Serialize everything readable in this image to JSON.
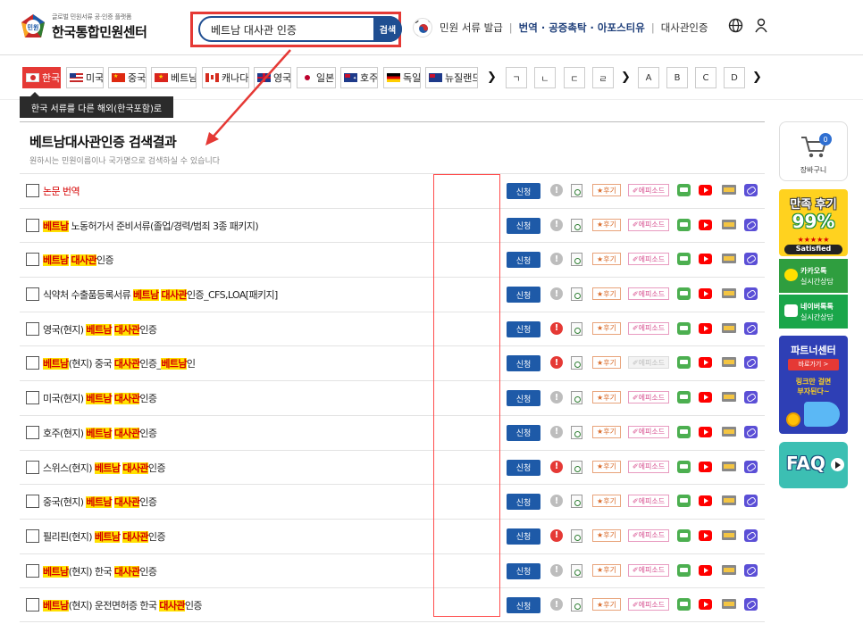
{
  "brand": {
    "subtitle": "글로벌 민원서류 공·인증 플랫폼",
    "title": "한국통합민원센터",
    "mark_text": "민원"
  },
  "search": {
    "value": "베트남 대사관 인증",
    "button": "검색"
  },
  "top_nav": {
    "item1": "민원 서류 발급",
    "item2": "번역 · 공증촉탁 · 아포스티유",
    "item3": "대사관인증"
  },
  "countries": [
    {
      "label": "한국",
      "flag": "kr",
      "active": true
    },
    {
      "label": "미국",
      "flag": "us"
    },
    {
      "label": "중국",
      "flag": "cn"
    },
    {
      "label": "베트남",
      "flag": "vn"
    },
    {
      "label": "캐나다",
      "flag": "ca"
    },
    {
      "label": "영국",
      "flag": "uk"
    },
    {
      "label": "일본",
      "flag": "jp"
    },
    {
      "label": "호주",
      "flag": "au"
    },
    {
      "label": "독일",
      "flag": "de"
    },
    {
      "label": "뉴질랜드",
      "flag": "nz"
    }
  ],
  "consonants": [
    "ㄱ",
    "ㄴ",
    "ㄷ",
    "ㄹ"
  ],
  "letters": [
    "A",
    "B",
    "C",
    "D"
  ],
  "tooltip": "한국 서류를 다른 해외(한국포함)로",
  "result": {
    "title": "베트남대사관인증 검색결과",
    "subtitle": "원하시는 민원이름이나 국가명으로 검색하실 수 있습니다"
  },
  "row_labels": {
    "apply": "신청",
    "review": "★후기",
    "episode": "✐에피소드",
    "info": "!"
  },
  "rows": [
    {
      "parts": [
        {
          "t": "논문 번역",
          "s": "red"
        }
      ],
      "excl": "gray",
      "doc_dim": true,
      "epi_dim": false
    },
    {
      "parts": [
        {
          "t": "베트남",
          "s": "hl"
        },
        {
          "t": " 노동허가서 준비서류(졸업/경력/범죄 3종 패키지)",
          "s": ""
        }
      ],
      "excl": "gray",
      "epi_dim": false
    },
    {
      "parts": [
        {
          "t": "베트남",
          "s": "hl"
        },
        {
          "t": " ",
          "s": ""
        },
        {
          "t": "대사관",
          "s": "hl"
        },
        {
          "t": "인증",
          "s": ""
        }
      ],
      "excl": "gray",
      "epi_dim": false
    },
    {
      "parts": [
        {
          "t": "식약처 수출품등록서류 ",
          "s": ""
        },
        {
          "t": "베트남",
          "s": "hl"
        },
        {
          "t": " ",
          "s": ""
        },
        {
          "t": "대사관",
          "s": "hl"
        },
        {
          "t": "인증_CFS,LOA[패키지]",
          "s": ""
        }
      ],
      "excl": "gray",
      "epi_dim": false
    },
    {
      "parts": [
        {
          "t": "영국(현지) ",
          "s": ""
        },
        {
          "t": "베트남",
          "s": "hl"
        },
        {
          "t": " ",
          "s": ""
        },
        {
          "t": "대사관",
          "s": "hl"
        },
        {
          "t": "인증",
          "s": ""
        }
      ],
      "excl": "red",
      "epi_dim": false
    },
    {
      "parts": [
        {
          "t": "베트남",
          "s": "hl"
        },
        {
          "t": "(현지) 중국 ",
          "s": ""
        },
        {
          "t": "대사관",
          "s": "hl"
        },
        {
          "t": "인증_",
          "s": ""
        },
        {
          "t": "베트남",
          "s": "hl"
        },
        {
          "t": "인",
          "s": ""
        }
      ],
      "excl": "red",
      "epi_dim": true
    },
    {
      "parts": [
        {
          "t": "미국(현지) ",
          "s": ""
        },
        {
          "t": "베트남",
          "s": "hl"
        },
        {
          "t": " ",
          "s": ""
        },
        {
          "t": "대사관",
          "s": "hl"
        },
        {
          "t": "인증",
          "s": ""
        }
      ],
      "excl": "gray",
      "epi_dim": false
    },
    {
      "parts": [
        {
          "t": "호주(현지) ",
          "s": ""
        },
        {
          "t": "베트남",
          "s": "hl"
        },
        {
          "t": " ",
          "s": ""
        },
        {
          "t": "대사관",
          "s": "hl"
        },
        {
          "t": "인증",
          "s": ""
        }
      ],
      "excl": "gray",
      "epi_dim": false
    },
    {
      "parts": [
        {
          "t": "스위스(현지) ",
          "s": ""
        },
        {
          "t": "베트남",
          "s": "hl"
        },
        {
          "t": " ",
          "s": ""
        },
        {
          "t": "대사관",
          "s": "hl"
        },
        {
          "t": "인증",
          "s": ""
        }
      ],
      "excl": "red",
      "epi_dim": false
    },
    {
      "parts": [
        {
          "t": "중국(현지) ",
          "s": ""
        },
        {
          "t": "베트남",
          "s": "hl"
        },
        {
          "t": " ",
          "s": ""
        },
        {
          "t": "대사관",
          "s": "hl"
        },
        {
          "t": "인증",
          "s": ""
        }
      ],
      "excl": "gray",
      "epi_dim": false
    },
    {
      "parts": [
        {
          "t": "필리핀(현지) ",
          "s": ""
        },
        {
          "t": "베트남",
          "s": "hl"
        },
        {
          "t": " ",
          "s": ""
        },
        {
          "t": "대사관",
          "s": "hl"
        },
        {
          "t": "인증",
          "s": ""
        }
      ],
      "excl": "red",
      "epi_dim": false
    },
    {
      "parts": [
        {
          "t": "베트남",
          "s": "hl"
        },
        {
          "t": "(현지) 한국 ",
          "s": ""
        },
        {
          "t": "대사관",
          "s": "hl"
        },
        {
          "t": "인증",
          "s": ""
        }
      ],
      "excl": "gray",
      "epi_dim": false
    },
    {
      "parts": [
        {
          "t": "베트남",
          "s": "hl"
        },
        {
          "t": "(현지) 운전면허증 한국 ",
          "s": ""
        },
        {
          "t": "대사관",
          "s": "hl"
        },
        {
          "t": "인증",
          "s": ""
        }
      ],
      "excl": "gray",
      "epi_dim": false
    }
  ],
  "sidebar": {
    "cart_label": "장바구니",
    "cart_count": "0",
    "review_line1": "만족 후기",
    "review_line2": "99%",
    "review_stars": "★★★★★",
    "review_line3": "Satisfied",
    "kakao_title": "카카오톡",
    "kakao_sub": "실시간상담",
    "naver_title": "네이버톡톡",
    "naver_sub": "실시간상담",
    "partner_title": "파트너센터",
    "partner_btn": "바로가기 >",
    "partner_copy1": "링크만 걸면",
    "partner_copy2": "부자된다~",
    "faq": "FAQ"
  },
  "colors": {
    "accent_red": "#e53935",
    "brand_blue": "#1f4e91",
    "apply_blue": "#1e5aa8",
    "highlight": "#ffe100"
  }
}
